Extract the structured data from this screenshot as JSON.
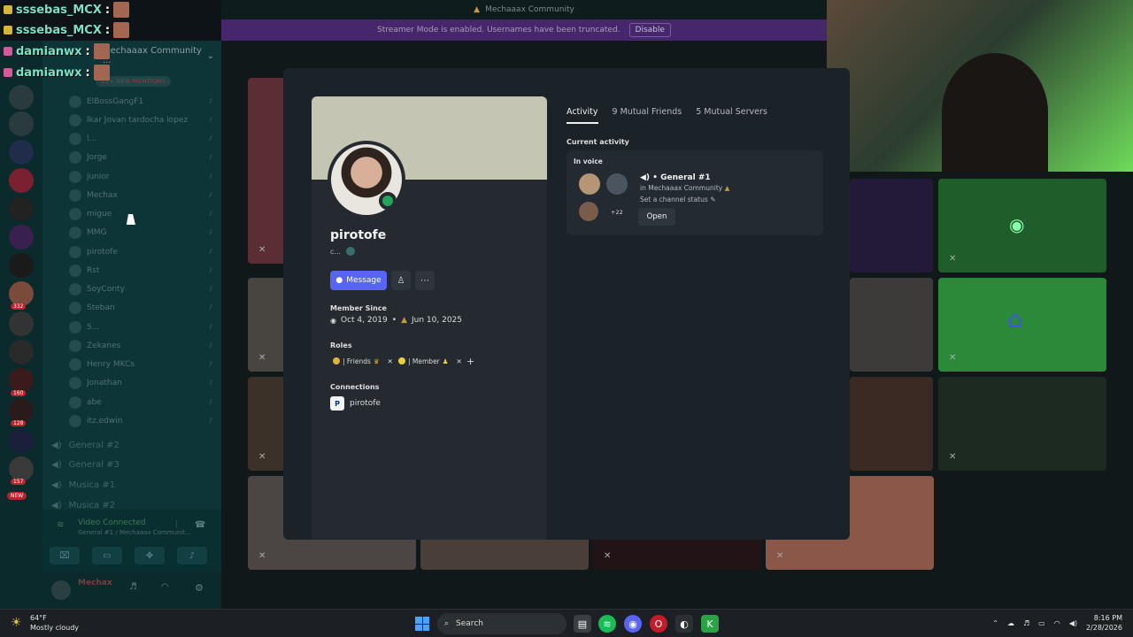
{
  "stream_overlay": {
    "chat": [
      {
        "user": "sssebas_MCX",
        "sep": ":"
      },
      {
        "user": "sssebas_MCX",
        "sep": ":"
      },
      {
        "user": "damianwx",
        "sep": ":"
      },
      {
        "user": "damianwx",
        "sep": ":"
      }
    ]
  },
  "topbar": {
    "server_name": "Mechaaax Community"
  },
  "streamer_banner": {
    "text": "Streamer Mode is enabled. Usernames have been truncated.",
    "disable_label": "Disable"
  },
  "sidebar": {
    "server_header": "Mechaaax Community ...",
    "new_mentions": "15+ NEW MENTIONS",
    "members": [
      "ElBossGangF1",
      "Ikar Jovan tardocha lopez",
      "l...",
      "Jorge",
      "junior",
      "Mechax",
      "migue",
      "MMG",
      "pirotofe",
      "Rst",
      "SoyConty",
      "Steban",
      "S...",
      "Zekanes",
      "Henry MKCs",
      "Jonathan",
      "abe",
      "itz.edwin"
    ],
    "voice_channels": [
      "General #2",
      "General #3",
      "Musica #1",
      "Musica #2"
    ],
    "voice_connected": "Video Connected",
    "voice_sub": "General #1 / Mechaaax Communit...",
    "user_name": "Mechax",
    "server_badges": [
      "332",
      "160",
      "128",
      "157"
    ],
    "new_badge": "NEW"
  },
  "profile": {
    "display_name": "pirotofe",
    "custom_status": "c...",
    "message_label": "Message",
    "member_since_label": "Member Since",
    "discord_join_date": "Oct 4, 2019",
    "server_join_date": "Jun 10, 2025",
    "roles_label": "Roles",
    "roles": [
      {
        "name": "| Friends",
        "color": "#e2b33b"
      },
      {
        "name": "| Member",
        "color": "#e8d23a"
      }
    ],
    "connections_label": "Connections",
    "connection_name": "pirotofe",
    "connection_icon": "playstation-icon"
  },
  "activity": {
    "tabs": [
      "Activity",
      "9 Mutual Friends",
      "5 Mutual Servers"
    ],
    "current_activity_label": "Current activity",
    "in_voice_label": "In voice",
    "channel_name": "General #1",
    "server_line": "in Mechaaax Community",
    "channel_status": "Set a channel status",
    "extra_count": "+22",
    "open_label": "Open"
  },
  "taskbar": {
    "temp": "64°F",
    "weather": "Mostly cloudy",
    "search_label": "Search",
    "time": "8:16 PM",
    "date": "2/28/2026"
  },
  "colors": {
    "accent": "#5865f2",
    "online": "#23a55a",
    "streamer_banner": "#47276b"
  }
}
